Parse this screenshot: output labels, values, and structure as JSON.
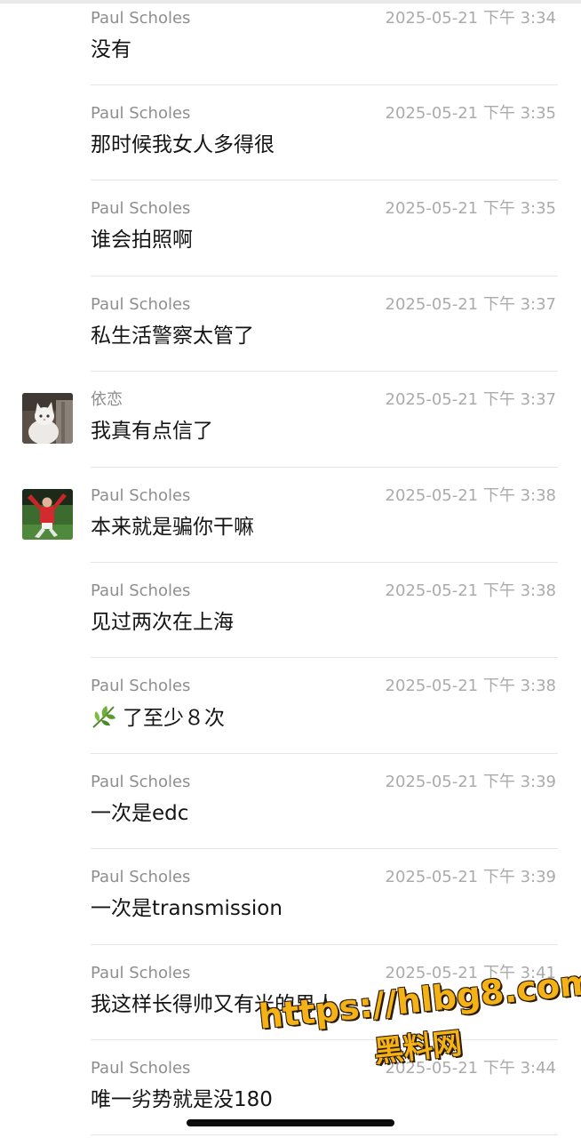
{
  "messages": [
    {
      "sender": "Paul Scholes",
      "time": "2025-05-21 下午 3:34",
      "text": "没有",
      "avatar": null
    },
    {
      "sender": "Paul Scholes",
      "time": "2025-05-21 下午 3:35",
      "text": "那时候我女人多得很",
      "avatar": null
    },
    {
      "sender": "Paul Scholes",
      "time": "2025-05-21 下午 3:35",
      "text": "谁会拍照啊",
      "avatar": null
    },
    {
      "sender": "Paul Scholes",
      "time": "2025-05-21 下午 3:37",
      "text": "私生活警察太管了",
      "avatar": null
    },
    {
      "sender": "依恋",
      "time": "2025-05-21 下午 3:37",
      "text": "我真有点信了",
      "avatar": "cat-avatar"
    },
    {
      "sender": "Paul Scholes",
      "time": "2025-05-21 下午 3:38",
      "text": "本来就是骗你干嘛",
      "avatar": "footballer-avatar"
    },
    {
      "sender": "Paul Scholes",
      "time": "2025-05-21 下午 3:38",
      "text": "见过两次在上海",
      "avatar": null
    },
    {
      "sender": "Paul Scholes",
      "time": "2025-05-21 下午 3:38",
      "text": "了至少８次",
      "avatar": null,
      "emoji": "herb-emoji"
    },
    {
      "sender": "Paul Scholes",
      "time": "2025-05-21 下午 3:39",
      "text": "一次是edc",
      "avatar": null
    },
    {
      "sender": "Paul Scholes",
      "time": "2025-05-21 下午 3:39",
      "text": "一次是transmission",
      "avatar": null
    },
    {
      "sender": "Paul Scholes",
      "time": "2025-05-21 下午 3:41",
      "text": "我这样长得帅又有米的男人",
      "avatar": null
    },
    {
      "sender": "Paul Scholes",
      "time": "2025-05-21 下午 3:44",
      "text": "唯一劣势就是没180",
      "avatar": null
    }
  ],
  "watermark": {
    "url": "https://hlbg8.com",
    "label": "黑料网",
    "color": "#f5b216"
  },
  "colors": {
    "sender": "#8e8e8e",
    "time": "#ababab",
    "text": "#151515",
    "divider": "#e6e6e6"
  }
}
